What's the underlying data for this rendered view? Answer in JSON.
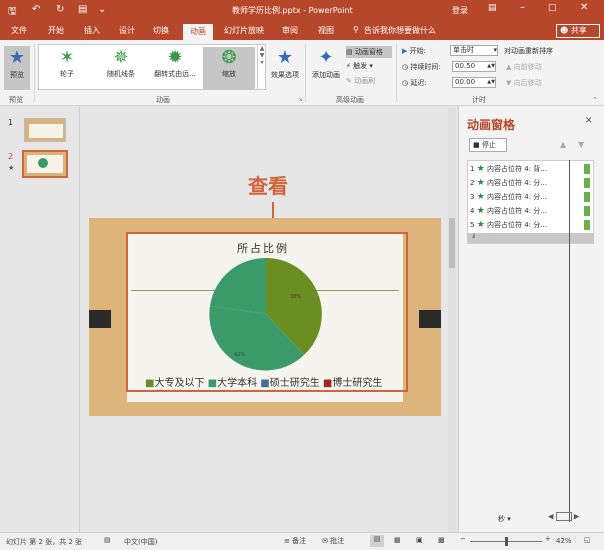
{
  "titlebar": {
    "filename": "教师学历比例.pptx",
    "separator": "-",
    "app": "PowerPoint",
    "login": "登录"
  },
  "tabs": [
    "文件",
    "开始",
    "插入",
    "设计",
    "切换",
    "动画",
    "幻灯片放映",
    "审阅",
    "视图"
  ],
  "tellme": "告诉我你想要做什么",
  "share": "共享",
  "ribbon": {
    "preview_label": "预览",
    "preview_group": "预览",
    "animations": [
      "轮子",
      "随机线条",
      "翻转式由远...",
      "缩放"
    ],
    "effect_options": "效果选项",
    "animation_group": "动画",
    "add_animation": "添加动画",
    "animation_pane": "动画窗格",
    "trigger": "触发",
    "painter": "动画刷",
    "advanced_group": "高级动画",
    "start_label": "开始:",
    "start_value": "单击时",
    "duration_label": "持续时间:",
    "duration_value": "00.50",
    "delay_label": "延迟:",
    "delay_value": "00.00",
    "reorder": "对动画重新排序",
    "move_earlier": "向前移动",
    "move_later": "向后移动",
    "timing_group": "计时"
  },
  "slides": [
    {
      "num": "1"
    },
    {
      "num": "2",
      "mark": "★"
    }
  ],
  "slide": {
    "title": "所占比例",
    "pct_green": "38%",
    "pct_teal": "42%",
    "legend": [
      "大专及以下",
      "大学本科",
      "硕士研究生",
      "博士研究生"
    ],
    "legend_colors": [
      "#6b8e23",
      "#3a9a6a",
      "#4a6a9a",
      "#9a2a2a"
    ]
  },
  "annotation": "查看",
  "pane": {
    "title": "动画窗格",
    "play": "停止",
    "items": [
      {
        "n": "1",
        "t": "内容占位符 4: 背..."
      },
      {
        "n": "2",
        "t": "内容占位符 4: 分..."
      },
      {
        "n": "3",
        "t": "内容占位符 4: 分..."
      },
      {
        "n": "4",
        "t": "内容占位符 4: 分..."
      },
      {
        "n": "5",
        "t": "内容占位符 4: 分..."
      }
    ],
    "seconds": "秒"
  },
  "status": {
    "slide": "幻灯片 第 2 张，共 2 张",
    "lang": "中文(中国)",
    "notes": "备注",
    "comments": "批注",
    "zoom": "42%"
  }
}
